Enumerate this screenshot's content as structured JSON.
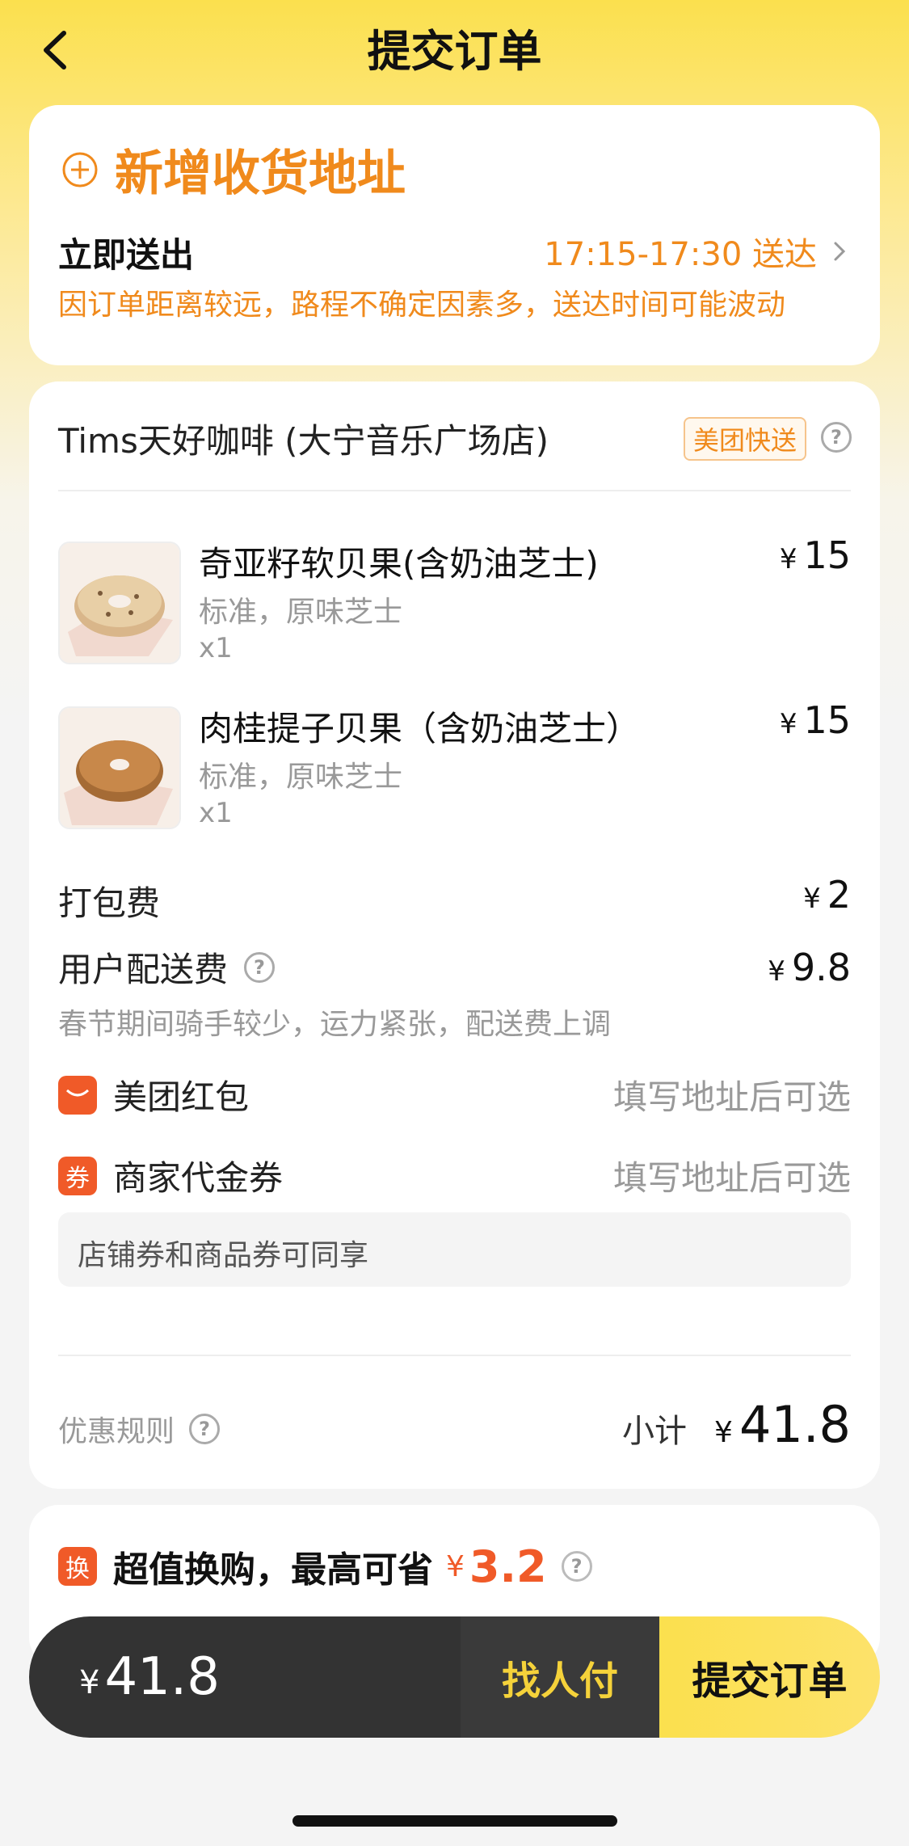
{
  "header": {
    "title": "提交订单"
  },
  "address_card": {
    "add_address_label": "新增收货地址",
    "deliver_label": "立即送出",
    "deliver_time": "17:15-17:30 送达",
    "deliver_note": "因订单距离较远，路程不确定因素多，送达时间可能波动"
  },
  "store": {
    "name": "Tims天好咖啡 (大宁音乐广场店)",
    "badge": "美团快送"
  },
  "items": [
    {
      "name": "奇亚籽软贝果(含奶油芝士)",
      "spec": "标准，原味芝士",
      "qty": "x1",
      "currency": "¥",
      "price": "15"
    },
    {
      "name": "肉桂提子贝果（含奶油芝士）",
      "spec": "标准，原味芝士",
      "qty": "x1",
      "currency": "¥",
      "price": "15"
    }
  ],
  "fees": {
    "packaging_label": "打包费",
    "packaging_currency": "¥",
    "packaging_price": "2",
    "delivery_label": "用户配送费",
    "delivery_currency": "¥",
    "delivery_price": "9.8",
    "delivery_note": "春节期间骑手较少，运力紧张，配送费上调"
  },
  "coupons": {
    "meituan_label": "美团红包",
    "meituan_hint": "填写地址后可选",
    "merchant_icon": "券",
    "merchant_label": "商家代金券",
    "merchant_hint": "填写地址后可选",
    "share_note": "店铺券和商品券可同享"
  },
  "summary": {
    "rules_label": "优惠规则",
    "subtotal_label": "小计",
    "subtotal_currency": "¥",
    "subtotal_value": "41.8"
  },
  "exchange": {
    "icon": "换",
    "label": "超值换购，最高可省",
    "currency": "¥",
    "value": "3.2"
  },
  "bottom_bar": {
    "currency": "¥",
    "total": "41.8",
    "friend_pay": "找人付",
    "submit": "提交订单"
  },
  "colors": {
    "accent_orange": "#f08a1c",
    "accent_red": "#f05a28",
    "brand_yellow": "#fbe04e"
  }
}
